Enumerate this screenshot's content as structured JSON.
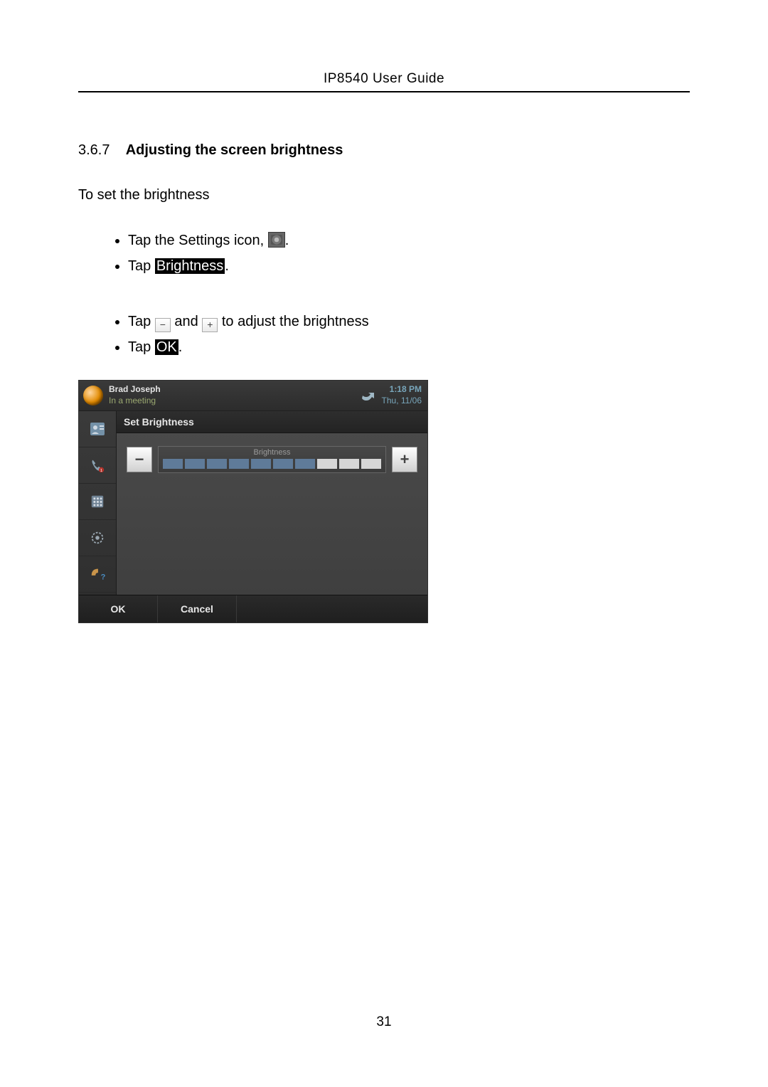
{
  "header": {
    "title": "IP8540 User Guide"
  },
  "section": {
    "number": "3.6.7",
    "title": "Adjusting the screen brightness"
  },
  "intro": "To set the brightness",
  "steps": {
    "s1a": "Tap the Settings icon, ",
    "s1b": ".",
    "s2a": "Tap ",
    "s2_hl": "Brightness",
    "s2b": ".",
    "s3a": "Tap ",
    "s3_mid": " and ",
    "s3b": " to adjust the brightness",
    "s4a": "Tap ",
    "s4_hl": "OK",
    "s4b": "."
  },
  "device": {
    "user_name": "Brad Joseph",
    "user_status": "In a meeting",
    "time": "1:18 PM",
    "date": "Thu, 11/06",
    "panel_title": "Set Brightness",
    "brightness_label": "Brightness",
    "minus": "−",
    "plus": "+",
    "ok": "OK",
    "cancel": "Cancel",
    "brightness_level": 7,
    "brightness_max": 10
  },
  "page_number": "31"
}
